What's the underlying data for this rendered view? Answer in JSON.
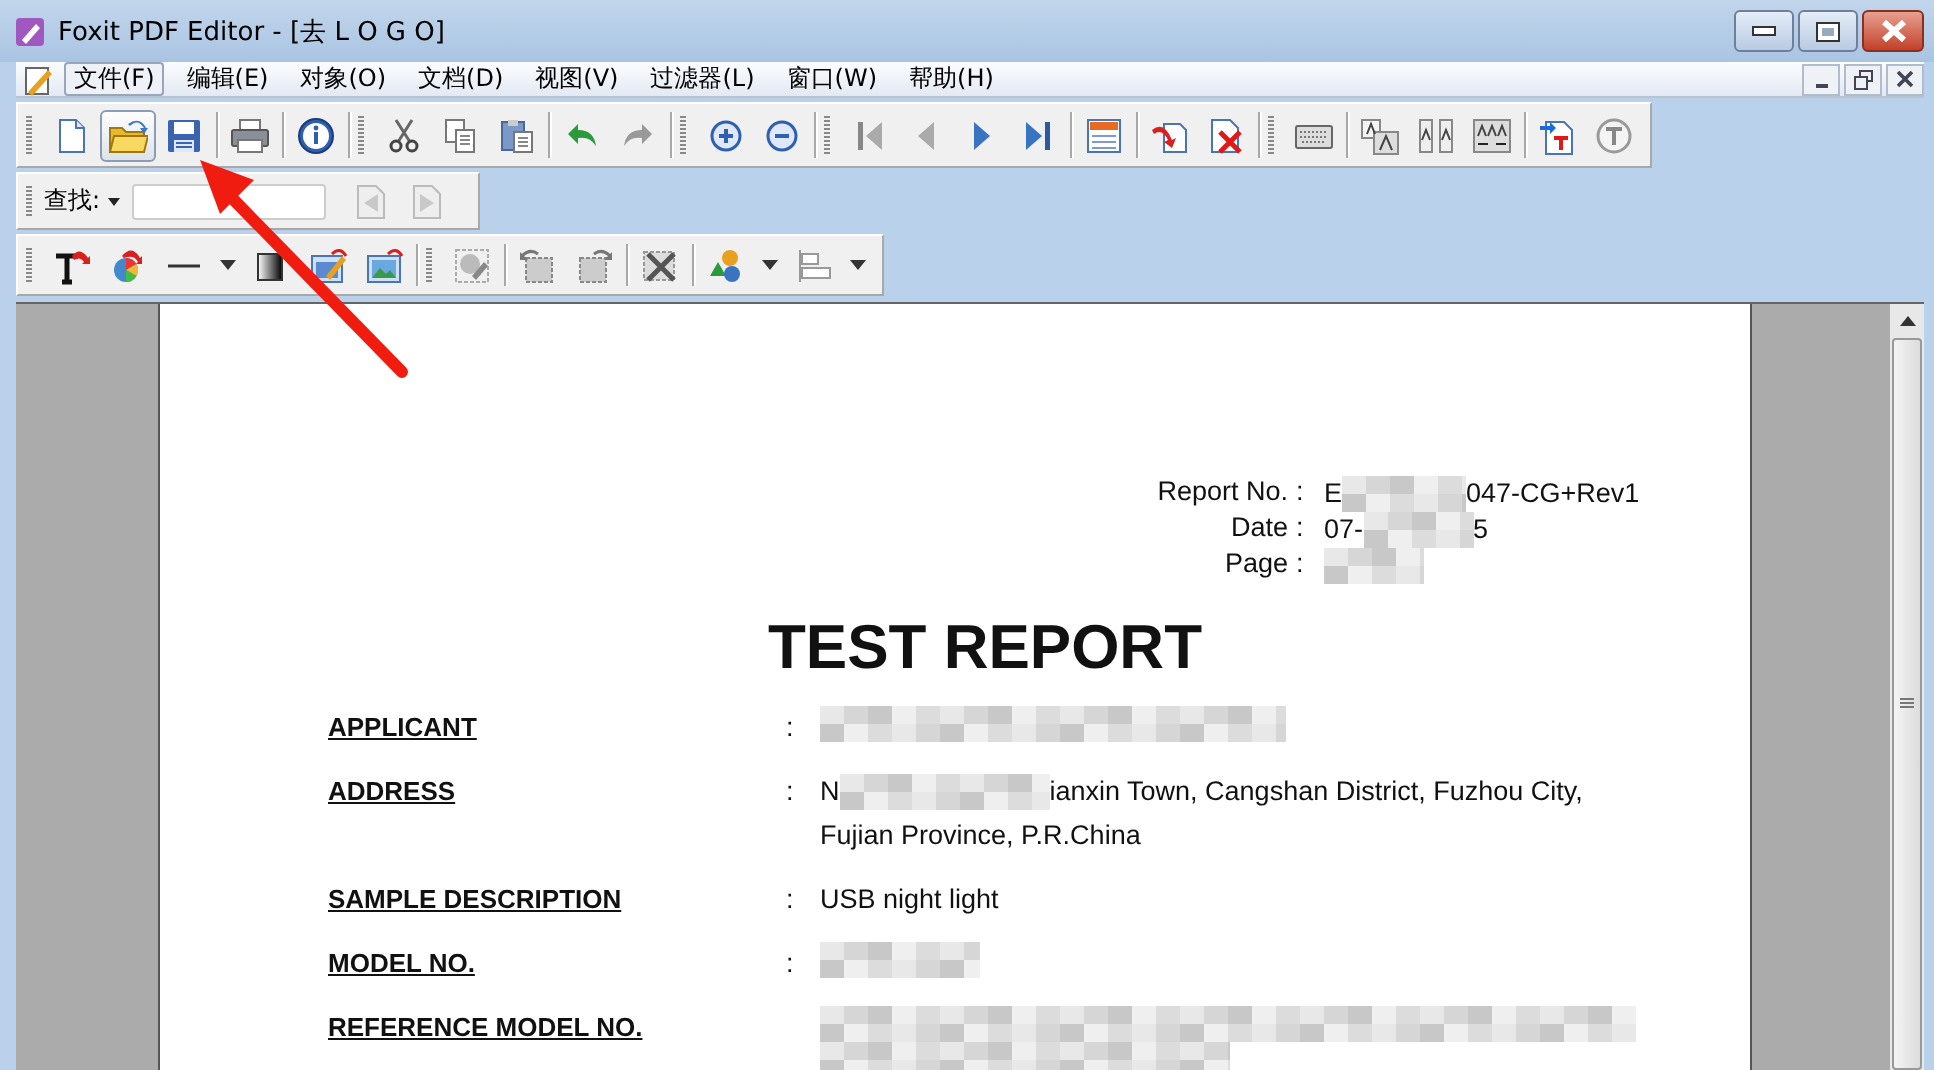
{
  "window": {
    "title": "Foxit PDF Editor - [去 L O G O]"
  },
  "menu": [
    {
      "label": "文件(F)",
      "selected": true
    },
    {
      "label": "编辑(E)",
      "selected": false
    },
    {
      "label": "对象(O)",
      "selected": false
    },
    {
      "label": "文档(D)",
      "selected": false
    },
    {
      "label": "视图(V)",
      "selected": false
    },
    {
      "label": "过滤器(L)",
      "selected": false
    },
    {
      "label": "窗口(W)",
      "selected": false
    },
    {
      "label": "帮助(H)",
      "selected": false
    }
  ],
  "toolbars": [
    {
      "groups": [
        [
          {
            "kind": "new",
            "pressed": false
          },
          {
            "kind": "open",
            "pressed": true
          },
          {
            "kind": "save",
            "pressed": false
          }
        ],
        [
          {
            "kind": "print",
            "pressed": false
          }
        ],
        [
          {
            "kind": "info",
            "pressed": false
          }
        ],
        [
          {
            "kind": "cut",
            "pressed": false
          },
          {
            "kind": "copy",
            "pressed": false
          },
          {
            "kind": "paste",
            "pressed": false
          }
        ],
        [
          {
            "kind": "undo",
            "pressed": false
          },
          {
            "kind": "redo",
            "pressed": false
          }
        ],
        [
          {
            "kind": "zoomin",
            "pressed": false
          },
          {
            "kind": "zoomout",
            "pressed": false
          }
        ],
        [
          {
            "kind": "first",
            "pressed": false
          },
          {
            "kind": "prev",
            "pressed": false
          },
          {
            "kind": "next",
            "pressed": false
          },
          {
            "kind": "last",
            "pressed": false
          }
        ],
        [
          {
            "kind": "form",
            "pressed": false
          }
        ],
        [
          {
            "kind": "rotate",
            "pressed": false
          },
          {
            "kind": "delete",
            "pressed": false
          }
        ],
        [
          {
            "kind": "keyboard",
            "pressed": false
          }
        ],
        [
          {
            "kind": "fontsize",
            "pressed": false
          },
          {
            "kind": "charspace",
            "pressed": false
          },
          {
            "kind": "wordspace",
            "pressed": false
          }
        ],
        [
          {
            "kind": "insert",
            "pressed": false
          },
          {
            "kind": "typewriter",
            "pressed": false
          }
        ]
      ]
    },
    {
      "groups": [
        [
          {
            "kind": "text",
            "pressed": false
          },
          {
            "kind": "color",
            "pressed": false
          },
          {
            "kind": "line",
            "pressed": false
          },
          {
            "kind": "caret",
            "pressed": false
          },
          {
            "kind": "gradient",
            "pressed": false
          },
          {
            "kind": "editimage",
            "pressed": false
          },
          {
            "kind": "image",
            "pressed": false
          }
        ],
        [
          {
            "kind": "select",
            "pressed": false
          }
        ],
        [
          {
            "kind": "rotleft",
            "pressed": false
          },
          {
            "kind": "rotright",
            "pressed": false
          }
        ],
        [
          {
            "kind": "cropx",
            "pressed": false
          }
        ],
        [
          {
            "kind": "shapes",
            "pressed": false
          },
          {
            "kind": "caret",
            "pressed": false
          },
          {
            "kind": "align",
            "pressed": false
          },
          {
            "kind": "caret",
            "pressed": false
          }
        ]
      ]
    }
  ],
  "find_bar": {
    "label": "查找:",
    "buttons": [
      {
        "kind": "findprev",
        "disabled": true
      },
      {
        "kind": "findnext",
        "disabled": true
      }
    ]
  },
  "document": {
    "header": [
      {
        "label": "Report No.",
        "colon": ":",
        "lines": [
          [
            {
              "kind": "text",
              "text": "E"
            },
            {
              "kind": "redaction"
            },
            {
              "kind": "text",
              "text": "047-CG+Rev1"
            }
          ]
        ]
      },
      {
        "label": "Date",
        "colon": ":",
        "lines": [
          [
            {
              "kind": "text",
              "text": "07-"
            },
            {
              "kind": "redaction"
            },
            {
              "kind": "text",
              "text": "5"
            }
          ]
        ]
      },
      {
        "label": "Page",
        "colon": ":",
        "lines": [
          [
            {
              "kind": "redaction"
            }
          ]
        ]
      }
    ],
    "title": "TEST REPORT",
    "fields": [
      {
        "label": "APPLICANT",
        "colon": ":",
        "lines": [
          [
            {
              "kind": "redaction"
            }
          ]
        ]
      },
      {
        "label": "ADDRESS",
        "colon": ":",
        "lines": [
          [
            {
              "kind": "text",
              "text": "N"
            },
            {
              "kind": "redaction"
            },
            {
              "kind": "text",
              "text": "ianxin Town, Cangshan District, Fuzhou City,"
            }
          ],
          [
            {
              "kind": "text",
              "text": "Fujian Province, P.R.China"
            }
          ]
        ]
      },
      {
        "label": "SAMPLE DESCRIPTION",
        "colon": ":",
        "lines": [
          [
            {
              "kind": "text",
              "text": "USB night light"
            }
          ]
        ]
      },
      {
        "label": "MODEL NO.",
        "colon": ":",
        "lines": [
          [
            {
              "kind": "redaction"
            }
          ]
        ]
      },
      {
        "label": "REFERENCE MODEL NO.",
        "lines": [
          [
            {
              "kind": "redaction"
            }
          ],
          [
            {
              "kind": "redaction"
            }
          ]
        ]
      }
    ]
  }
}
